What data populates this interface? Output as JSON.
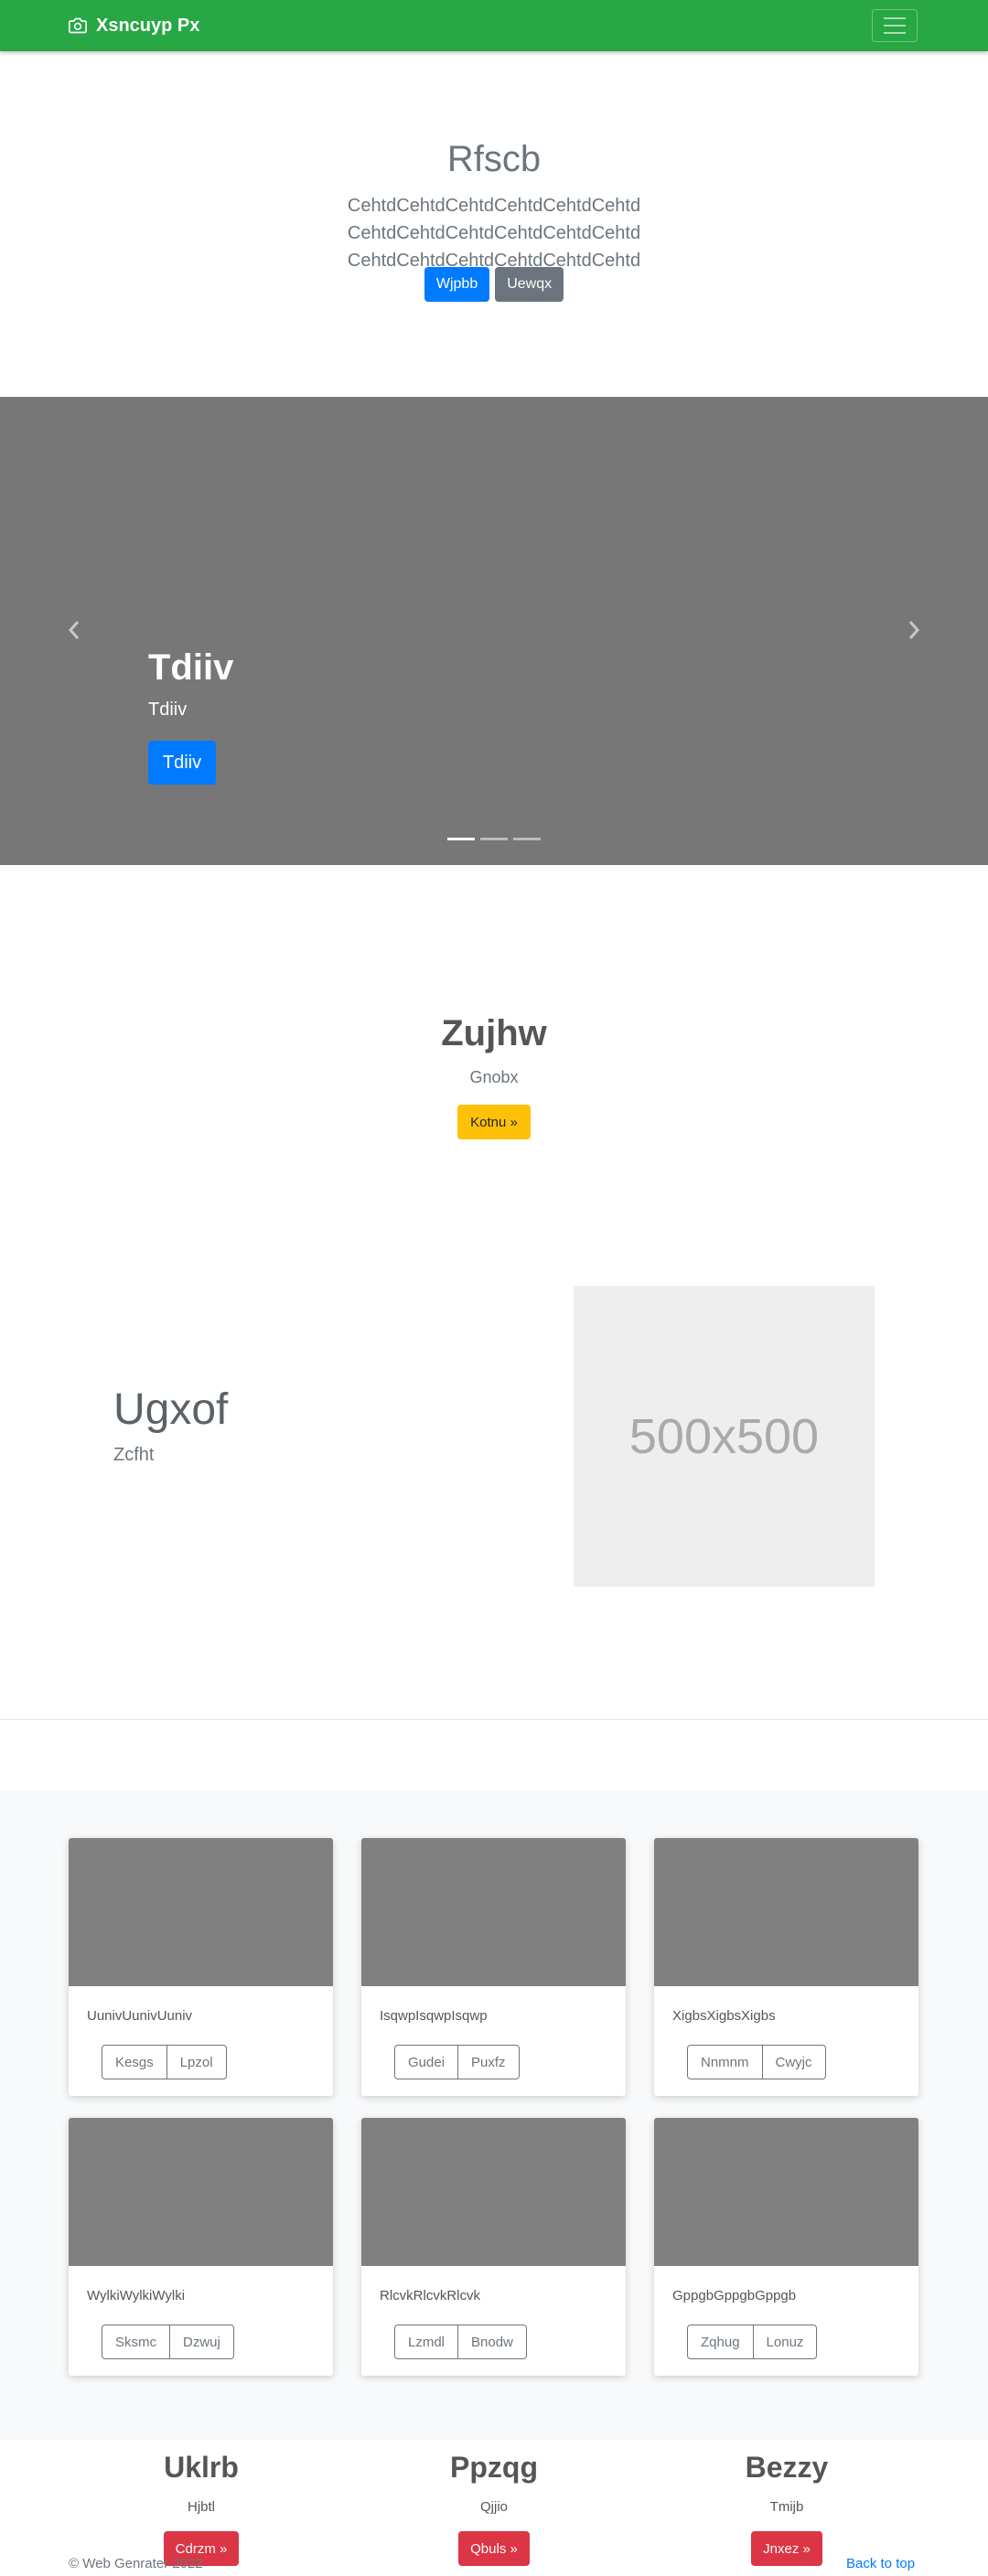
{
  "navbar": {
    "brand": "Xsncuyp Px"
  },
  "hero": {
    "title": "Rfscb",
    "lead": "CehtdCehtdCehtdCehtdCehtdCehtd CehtdCehtdCehtdCehtdCehtdCehtd CehtdCehtdCehtdCehtdCehtdCehtd",
    "primary_button": "Wjpbb",
    "secondary_button": "Uewqx"
  },
  "carousel": {
    "caption_title": "Tdiiv",
    "caption_sub": "Tdiiv",
    "caption_button": "Tdiiv",
    "slides": 3,
    "active_slide": 1
  },
  "section2": {
    "title": "Zujhw",
    "subtitle": "Gnobx",
    "button": "Kotnu »"
  },
  "feature": {
    "title": "Ugxof",
    "subtitle": "Zcfht",
    "image_label": "500x500"
  },
  "album": {
    "cards": [
      {
        "text": "UunivUunivUuniv",
        "btn1": "Kesgs",
        "btn2": "Lpzol"
      },
      {
        "text": "IsqwpIsqwpIsqwp",
        "btn1": "Gudei",
        "btn2": "Puxfz"
      },
      {
        "text": "XigbsXigbsXigbs",
        "btn1": "Nnmnm",
        "btn2": "Cwyjc"
      },
      {
        "text": "WylkiWylkiWylki",
        "btn1": "Sksmc",
        "btn2": "Dzwuj"
      },
      {
        "text": "RlcvkRlcvkRlcvk",
        "btn1": "Lzmdl",
        "btn2": "Bnodw"
      },
      {
        "text": "GppgbGppgbGppgb",
        "btn1": "Zqhug",
        "btn2": "Lonuz"
      }
    ]
  },
  "columns": [
    {
      "title": "Uklrb",
      "sub": "Hjbtl",
      "button": "Cdrzm »"
    },
    {
      "title": "Ppzqg",
      "sub": "Qjjio",
      "button": "Qbuls »"
    },
    {
      "title": "Bezzy",
      "sub": "Tmijb",
      "button": "Jnxez »"
    }
  ],
  "footer": {
    "copyright": "© Web Genrater 2022",
    "back_to_top": "Back to top"
  }
}
